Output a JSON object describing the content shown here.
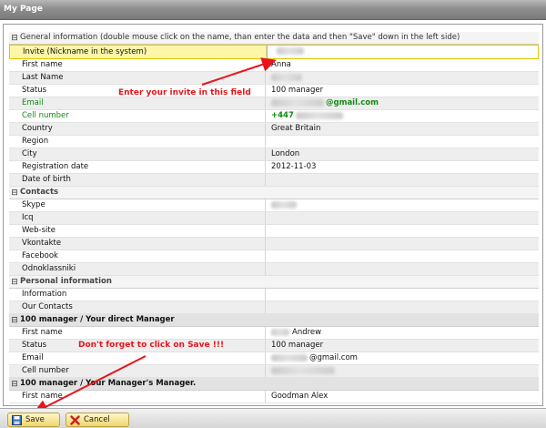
{
  "window": {
    "title": "My Page"
  },
  "sections": {
    "general": "General information (double mouse click on the name, than enter the data and then \"Save\" down in the left side)",
    "contacts": "Contacts",
    "personal": "Personal information",
    "manager": "100 manager / Your direct Manager",
    "managers_manager": "100 manager / Your Manager's Manager."
  },
  "general": {
    "invite_label": "Invite (Nickname in the system)",
    "first_name_label": "First name",
    "first_name_value": "Anna",
    "last_name_label": "Last Name",
    "status_label": "Status",
    "status_value": "100 manager",
    "email_label": "Email",
    "email_value": "@gmail.com",
    "cell_label": "Cell number",
    "cell_value": "+447",
    "country_label": "Country",
    "country_value": "Great Britain",
    "region_label": "Region",
    "city_label": "City",
    "city_value": "London",
    "reg_date_label": "Registration date",
    "reg_date_value": "2012-11-03",
    "dob_label": "Date of birth"
  },
  "contacts": {
    "skype_label": "Skype",
    "icq_label": "Icq",
    "website_label": "Web-site",
    "vkontakte_label": "Vkontakte",
    "facebook_label": "Facebook",
    "odnoklassniki_label": "Odnoklassniki"
  },
  "personal": {
    "information_label": "Information",
    "our_contacts_label": "Our Contacts"
  },
  "manager": {
    "first_name_label": "First name",
    "first_name_value": "Andrew",
    "status_label": "Status",
    "status_value": "100 manager",
    "email_label": "Email",
    "email_value": "@gmail.com",
    "cell_label": "Cell number"
  },
  "managers_manager": {
    "first_name_label": "First name",
    "first_name_value": "Goodman Alex"
  },
  "annotations": {
    "invite_hint": "Enter your invite in this field",
    "save_hint": "Don't forget to click on Save !!!"
  },
  "toolbar": {
    "save_label": "Save",
    "cancel_label": "Cancel"
  },
  "colors": {
    "annotation_red": "#e8141b",
    "email_green": "#138a13",
    "invite_highlight": "#fff6a8"
  }
}
